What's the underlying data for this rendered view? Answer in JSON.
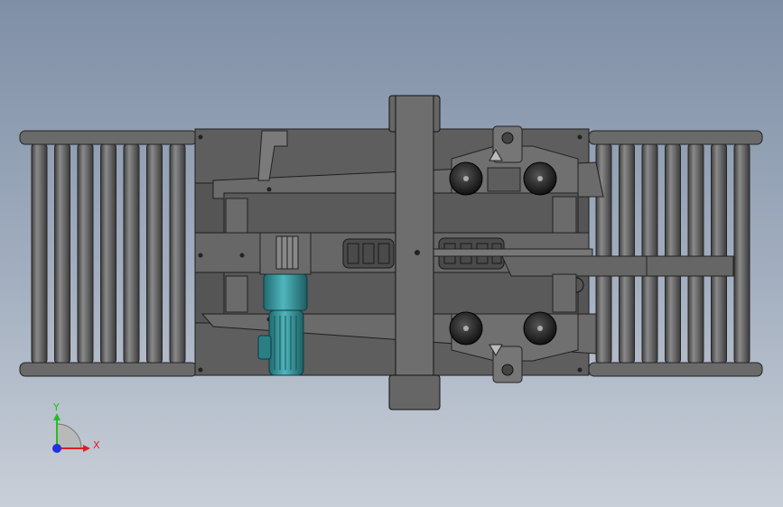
{
  "app": {
    "title": "",
    "view": "top"
  },
  "triad": {
    "x_label": "X",
    "y_label": "Y",
    "x_color": "#e02020",
    "y_color": "#20c020",
    "z_color": "#2030e0"
  },
  "model": {
    "description_icon": "conveyor-assembly-icon",
    "metal_color": "#5f5f5f",
    "motor_color": "#2e8f96",
    "roller_color": "#6b6b6b",
    "background_top": "#7f8fa6",
    "background_bottom": "#c9cfd8"
  }
}
